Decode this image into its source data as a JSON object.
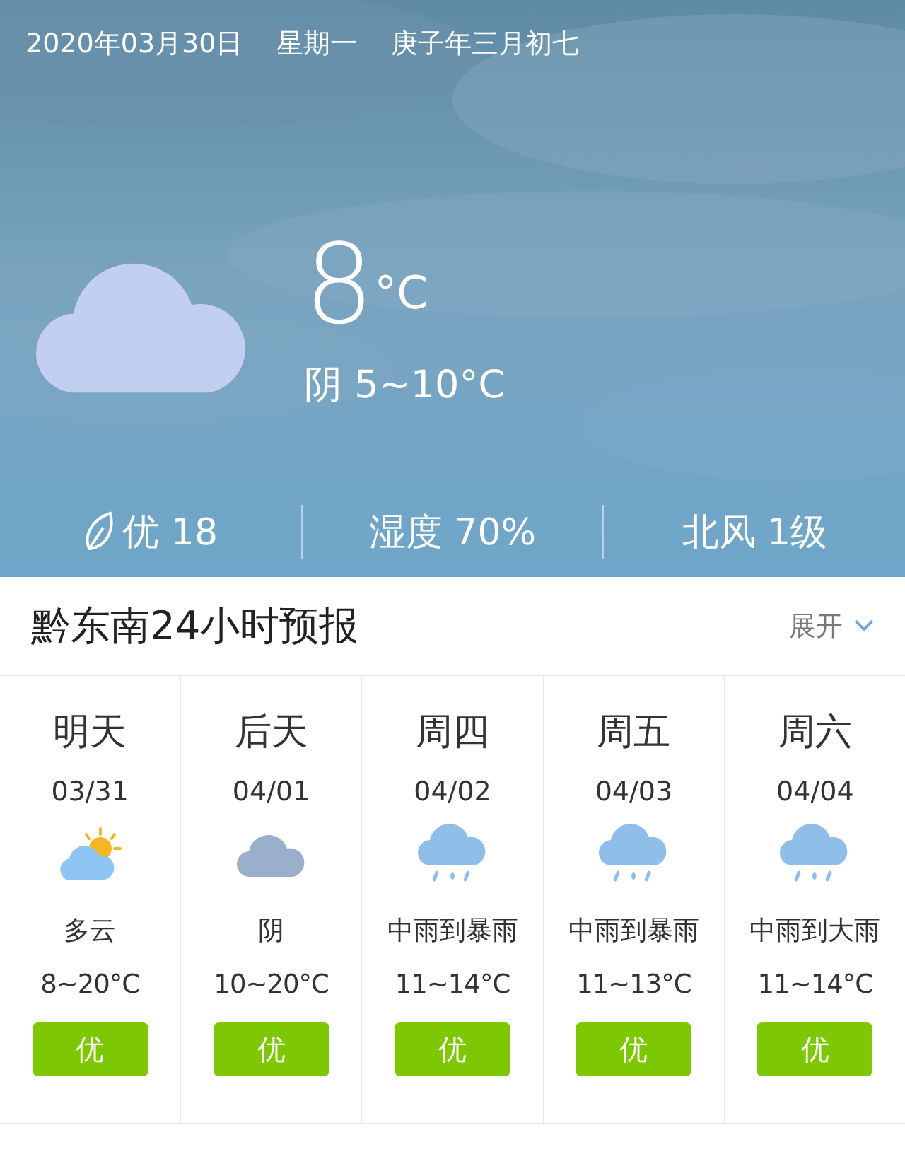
{
  "header": {
    "date": "2020年03月30日",
    "weekday": "星期一",
    "lunar_date": "庚子年三月初七"
  },
  "current": {
    "kind": "overcast",
    "temperature": "8",
    "unit": "°C",
    "condition": "阴 5~10°C"
  },
  "stats": [
    {
      "kind": "air",
      "text": "优 18"
    },
    {
      "kind": "plain",
      "text": "湿度 70%"
    },
    {
      "kind": "plain",
      "text": "北风 1级"
    }
  ],
  "forecast_section": {
    "title": "黔东南24小时预报",
    "expand_label": "展开"
  },
  "days": [
    {
      "day": "明天",
      "date": "03/31",
      "kind": "partly-cloudy",
      "condition": "多云",
      "temperature": "8~20°C",
      "air_quality": "优",
      "color": "#7dc802"
    },
    {
      "day": "后天",
      "date": "04/01",
      "kind": "overcast",
      "condition": "阴",
      "temperature": "10~20°C",
      "air_quality": "优",
      "color": "#7dc802"
    },
    {
      "day": "周四",
      "date": "04/02",
      "kind": "rain",
      "condition": "中雨到暴雨",
      "temperature": "11~14°C",
      "air_quality": "优",
      "color": "#7dc802"
    },
    {
      "day": "周五",
      "date": "04/03",
      "kind": "rain",
      "condition": "中雨到暴雨",
      "temperature": "11~13°C",
      "air_quality": "优",
      "color": "#7dc802"
    },
    {
      "day": "周六",
      "date": "04/04",
      "kind": "rain",
      "condition": "中雨到大雨",
      "temperature": "11~14°C",
      "air_quality": "优",
      "color": "#7dc802"
    }
  ]
}
